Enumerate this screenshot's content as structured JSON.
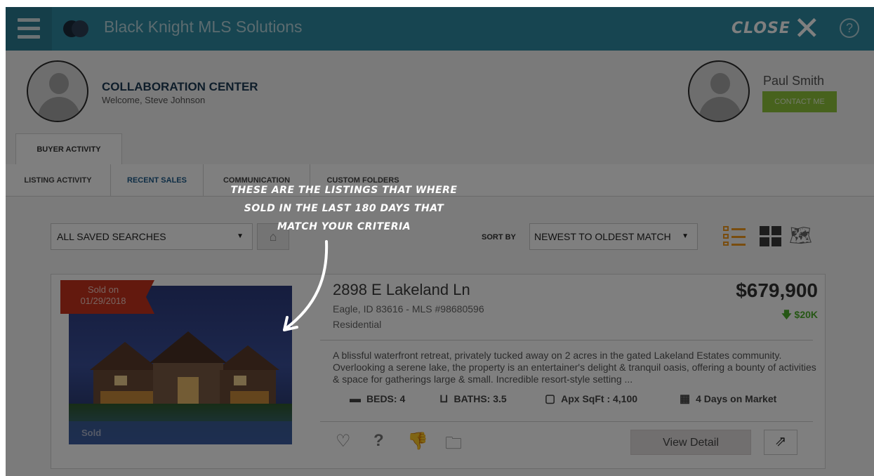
{
  "topbar": {
    "brand": "Black Knight MLS Solutions",
    "close_label": "CLOSE",
    "close_glyph": "✕",
    "help_glyph": "?"
  },
  "header": {
    "title": "COLLABORATION CENTER",
    "welcome": "Welcome, Steve Johnson",
    "agent_name": "Paul Smith",
    "contact_label": "CONTACT ME",
    "buyer_tab": "BUYER ACTIVITY"
  },
  "subnav": {
    "tabs": [
      {
        "label": "LISTING ACTIVITY"
      },
      {
        "label": "RECENT SALES"
      },
      {
        "label": "COMMUNICATION"
      },
      {
        "label": "CUSTOM FOLDERS"
      }
    ]
  },
  "toolbar": {
    "saved_searches": "ALL SAVED SEARCHES",
    "sort_label": "SORT BY",
    "sort_value": "NEWEST TO OLDEST MATCH"
  },
  "tutorial": {
    "callout_lines": [
      "THESE ARE THE LISTINGS THAT WHERE",
      "SOLD IN THE LAST 180 DAYS THAT",
      "MATCH YOUR CRITERIA"
    ]
  },
  "listing": {
    "sold_label": "Sold on",
    "sold_date": "01/29/2018",
    "status": "Sold",
    "address": "2898 E Lakeland Ln",
    "city_line": "Eagle, ID 83616 - MLS #98680596",
    "property_type": "Residential",
    "price": "$679,900",
    "price_drop": "$20K",
    "description": "A blissful waterfront retreat, privately tucked away on 2 acres in the gated Lakeland Estates community. Overlooking a serene lake, the property is an entertainer's delight & tranquil oasis, offering a bounty of activities & space for gatherings large & small. Incredible resort-style setting ...",
    "beds": "BEDS: 4",
    "baths": "BATHS: 3.5",
    "sqft": "Apx SqFt : 4,100",
    "dom": "4 Days on Market",
    "view_detail": "View Detail"
  }
}
